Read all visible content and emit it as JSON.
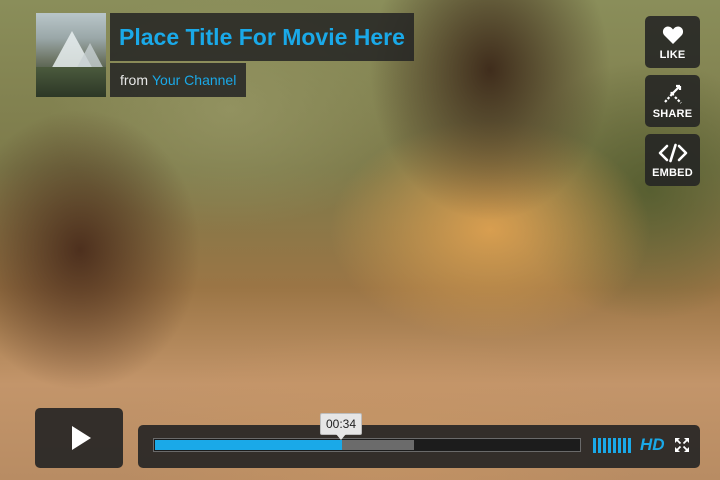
{
  "video": {
    "title": "Place Title For Movie Here",
    "byline_prefix": "from",
    "channel": "Your Channel"
  },
  "side_buttons": {
    "like": {
      "label": "LIKE",
      "icon": "heart-icon"
    },
    "share": {
      "label": "SHARE",
      "icon": "share-icon"
    },
    "embed": {
      "label": "EMBED",
      "icon": "embed-code-icon"
    }
  },
  "controls": {
    "play_icon": "play-icon",
    "current_time": "00:34",
    "played_fraction": 0.44,
    "loaded_fraction": 0.61,
    "volume_bars": 8,
    "volume_level": 1.0,
    "hd_label": "HD",
    "fullscreen_icon": "fullscreen-icon"
  },
  "colors": {
    "accent": "#1aa9e8",
    "panel": "#232323",
    "text": "#ffffff"
  }
}
